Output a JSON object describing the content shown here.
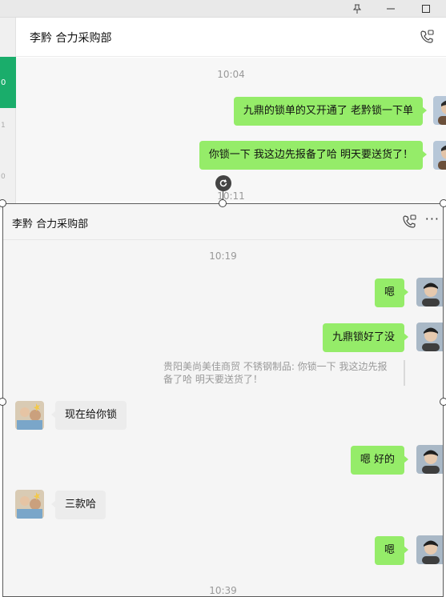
{
  "background_window": {
    "title": "李黔 合力采购部",
    "sidebar_highlight_text": "0",
    "sidebar_numbers": [
      "1",
      "0"
    ],
    "messages": [
      {
        "time": "10:04"
      },
      {
        "side": "right",
        "text": "九鼎的锁单的又开通了 老黔锁一下单"
      },
      {
        "side": "right",
        "text": "你锁一下 我这边先报备了哈 明天要送货了！"
      },
      {
        "time": "10:11"
      }
    ]
  },
  "foreground_window": {
    "title": "李黔 合力采购部",
    "more_label": "···",
    "messages": [
      {
        "time": "10:19"
      },
      {
        "side": "right",
        "text": "嗯"
      },
      {
        "side": "right",
        "text": "九鼎锁好了没"
      },
      {
        "quote": "贵阳美尚美佳商贸 不锈钢制品: 你锁一下 我这边先报备了哈 明天要送货了！"
      },
      {
        "side": "left",
        "text": "现在给你锁"
      },
      {
        "side": "right",
        "text": "嗯 好的"
      },
      {
        "side": "left",
        "text": "三款哈"
      },
      {
        "side": "right",
        "text": "嗯"
      },
      {
        "time": "10:39"
      }
    ]
  },
  "colors": {
    "bubble_self": "#95ec69",
    "bubble_other": "#ececec",
    "sidebar_accent": "#1aad6b"
  }
}
